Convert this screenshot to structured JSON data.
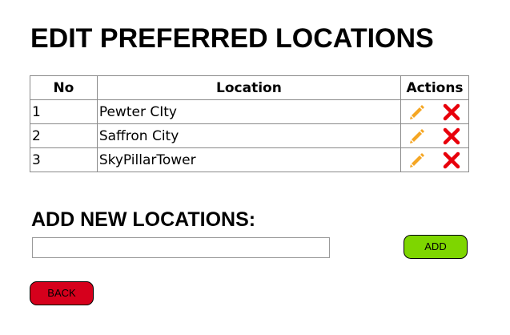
{
  "header": {
    "title": "EDIT PREFERRED LOCATIONS"
  },
  "table": {
    "columns": [
      "No",
      "Location",
      "Actions"
    ],
    "rows": [
      {
        "no": "1",
        "location": "Pewter CIty"
      },
      {
        "no": "2",
        "location": "Saffron City"
      },
      {
        "no": "3",
        "location": "SkyPillarTower"
      }
    ],
    "actions": {
      "edit_icon": "pencil-icon",
      "delete_icon": "x-icon"
    }
  },
  "add_section": {
    "title": "ADD NEW LOCATIONS:",
    "input_value": "",
    "add_label": "ADD"
  },
  "back_label": "BACK",
  "colors": {
    "edit_icon": "#f5a623",
    "delete_icon": "#e8000b",
    "add_button": "#7ed600",
    "back_button": "#d6001c",
    "table_border": "#8a8a8a"
  }
}
